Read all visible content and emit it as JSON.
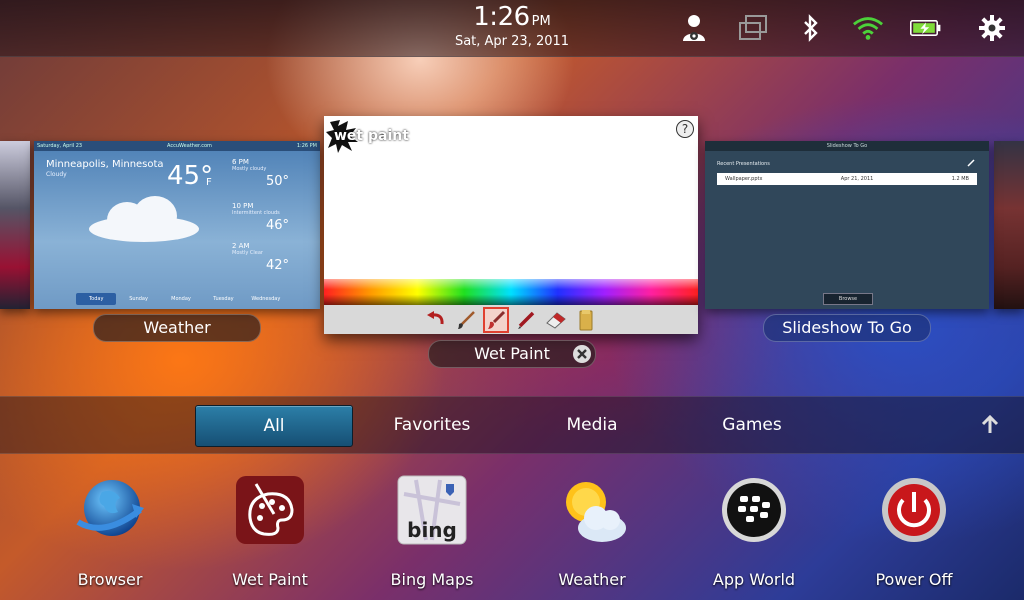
{
  "status": {
    "time": "1:26",
    "ampm": "PM",
    "date": "Sat, Apr 23, 2011"
  },
  "cards": {
    "weather": {
      "label": "Weather",
      "header_date": "Saturday, April 23",
      "header_source": "AccuWeather.com",
      "header_time": "1:26 PM",
      "city": "Minneapolis, Minnesota",
      "condition": "Cloudy",
      "temp": "45°",
      "unit": "F",
      "forecasts": [
        {
          "time": "6 PM",
          "cond": "Mostly cloudy",
          "temp": "50°"
        },
        {
          "time": "10 PM",
          "cond": "Intermittent clouds",
          "temp": "46°"
        },
        {
          "time": "2 AM",
          "cond": "Mostly Clear",
          "temp": "42°"
        }
      ],
      "days": [
        "Today",
        "Sunday",
        "Monday",
        "Tuesday",
        "Wednesday"
      ]
    },
    "wetpaint": {
      "label": "Wet Paint",
      "logo": "wet paint",
      "help": "?"
    },
    "slideshow": {
      "label": "Slideshow To Go",
      "header": "Slideshow To Go",
      "recent": "Recent Presentations",
      "file_name": "Wallpaper.pptx",
      "file_date": "Apr 21, 2011",
      "file_size": "1.2 MB",
      "browse": "Browse"
    }
  },
  "tabs": [
    "All",
    "Favorites",
    "Media",
    "Games"
  ],
  "apps": [
    {
      "name": "Browser"
    },
    {
      "name": "Wet Paint"
    },
    {
      "name": "Bing Maps"
    },
    {
      "name": "Weather"
    },
    {
      "name": "App World"
    },
    {
      "name": "Power Off"
    }
  ],
  "bing_text": "bing",
  "colors": {
    "active_tab": "#2c7fa8",
    "battery": "#7fdc3a",
    "wifi": "#4cd13a"
  }
}
